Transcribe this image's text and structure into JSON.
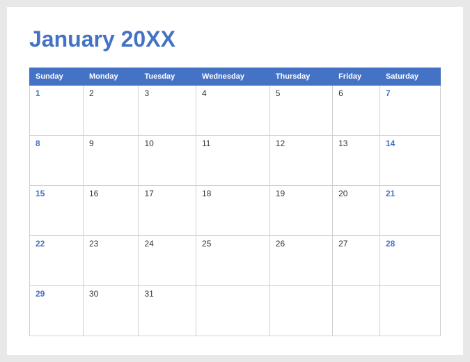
{
  "title": "January 20XX",
  "dayHeaders": [
    "Sunday",
    "Monday",
    "Tuesday",
    "Wednesday",
    "Thursday",
    "Friday",
    "Saturday"
  ],
  "weeks": [
    [
      {
        "day": "1",
        "weekend": true
      },
      {
        "day": "2",
        "weekend": false
      },
      {
        "day": "3",
        "weekend": false
      },
      {
        "day": "4",
        "weekend": false
      },
      {
        "day": "5",
        "weekend": false
      },
      {
        "day": "6",
        "weekend": false
      },
      {
        "day": "7",
        "weekend": true
      }
    ],
    [
      {
        "day": "8",
        "weekend": true
      },
      {
        "day": "9",
        "weekend": false
      },
      {
        "day": "10",
        "weekend": false
      },
      {
        "day": "11",
        "weekend": false
      },
      {
        "day": "12",
        "weekend": false
      },
      {
        "day": "13",
        "weekend": false
      },
      {
        "day": "14",
        "weekend": true
      }
    ],
    [
      {
        "day": "15",
        "weekend": true
      },
      {
        "day": "16",
        "weekend": false
      },
      {
        "day": "17",
        "weekend": false
      },
      {
        "day": "18",
        "weekend": false
      },
      {
        "day": "19",
        "weekend": false
      },
      {
        "day": "20",
        "weekend": false
      },
      {
        "day": "21",
        "weekend": true
      }
    ],
    [
      {
        "day": "22",
        "weekend": true
      },
      {
        "day": "23",
        "weekend": false
      },
      {
        "day": "24",
        "weekend": false
      },
      {
        "day": "25",
        "weekend": false
      },
      {
        "day": "26",
        "weekend": false
      },
      {
        "day": "27",
        "weekend": false
      },
      {
        "day": "28",
        "weekend": true
      }
    ],
    [
      {
        "day": "29",
        "weekend": true
      },
      {
        "day": "30",
        "weekend": false
      },
      {
        "day": "31",
        "weekend": false
      },
      {
        "day": "",
        "weekend": false
      },
      {
        "day": "",
        "weekend": false
      },
      {
        "day": "",
        "weekend": false
      },
      {
        "day": "",
        "weekend": false
      }
    ]
  ]
}
